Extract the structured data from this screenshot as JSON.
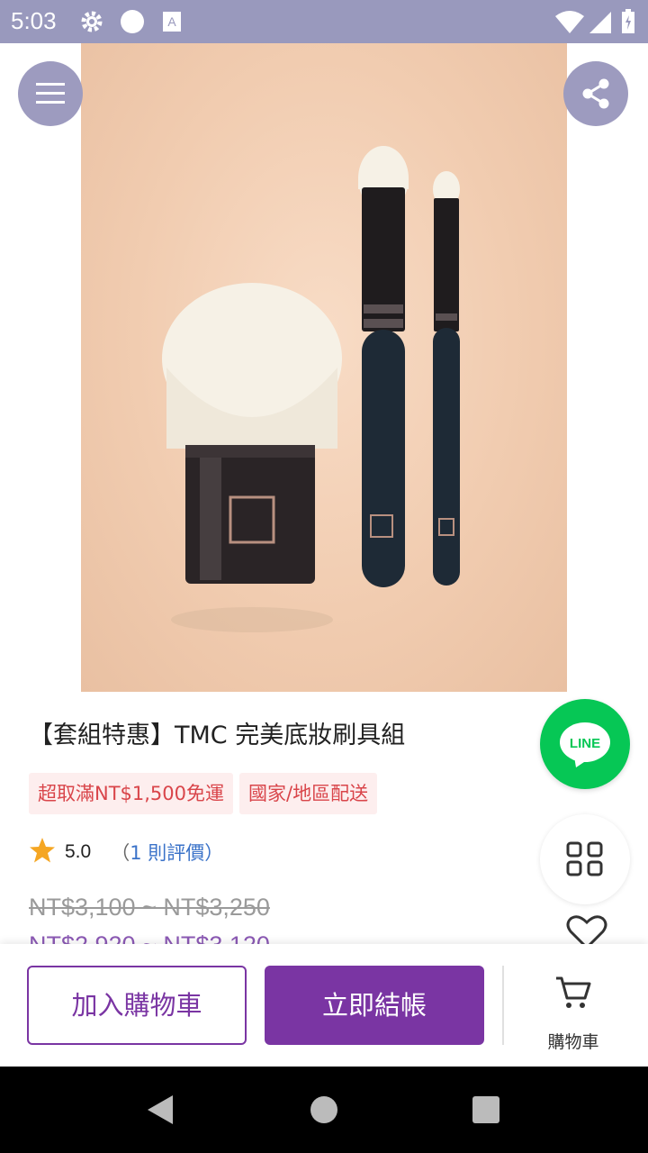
{
  "status_bar": {
    "time": "5:03",
    "icons": [
      "gear-icon",
      "circle-icon",
      "keyboard-a-icon",
      "wifi-icon",
      "signal-icon",
      "battery-icon"
    ]
  },
  "header": {
    "menu_icon": "hamburger-menu-icon",
    "share_icon": "share-icon"
  },
  "product": {
    "title": "【套組特惠】TMC 完美底妝刷具組",
    "tags": [
      "超取滿NT$1,500免運",
      "國家/地區配送"
    ],
    "rating": "5.0",
    "review_prefix": "（",
    "review_count": "1",
    "review_suffix": " 則評價）",
    "price_original": "NT$3,100 ~ NT$3,250",
    "price_sale": "NT$2,920 ~ NT$3,120"
  },
  "floating": {
    "line_label": "LINE"
  },
  "action_bar": {
    "add_to_cart": "加入購物車",
    "checkout": "立即結帳",
    "cart_label": "購物車"
  },
  "colors": {
    "primary": "#7a35a3",
    "status_bar": "#9999bd",
    "line_green": "#06c755",
    "tag_text": "#d9454a",
    "tag_bg": "#fdeeee",
    "star": "#f5a623",
    "review_link": "#3b73c9"
  }
}
